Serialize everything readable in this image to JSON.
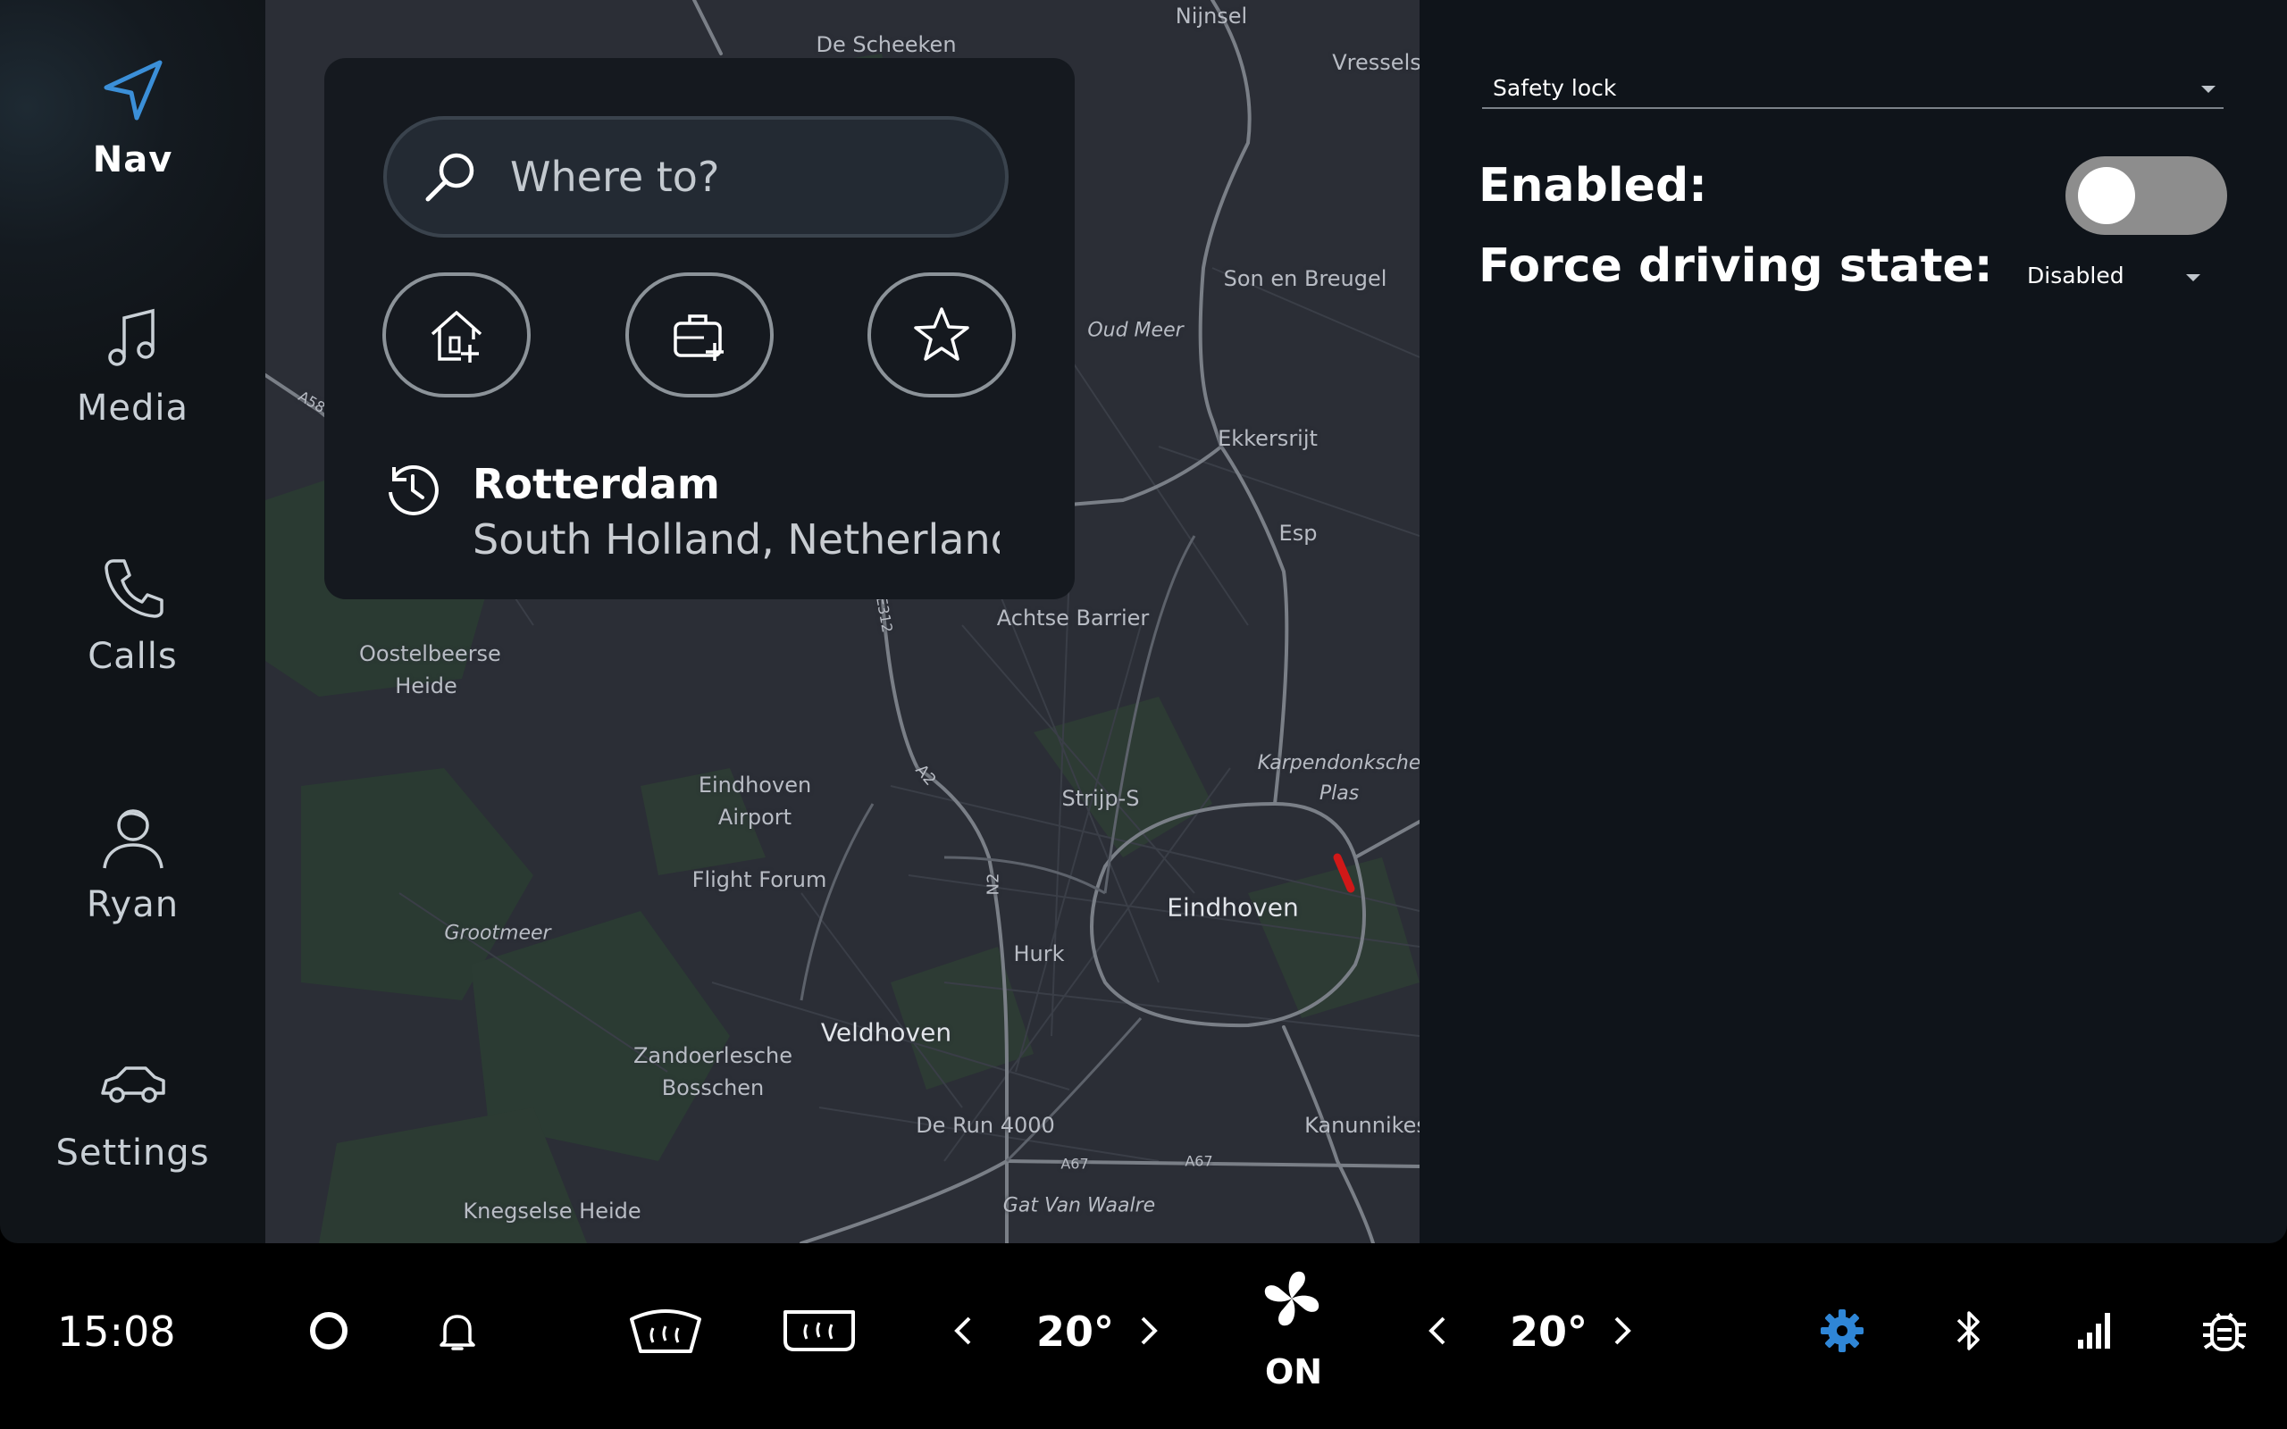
{
  "sidebar": {
    "items": [
      {
        "label": "Nav",
        "icon": "navigation-arrow-icon",
        "active": true
      },
      {
        "label": "Media",
        "icon": "music-note-icon"
      },
      {
        "label": "Calls",
        "icon": "phone-icon"
      },
      {
        "label": "Ryan",
        "icon": "user-profile-icon"
      },
      {
        "label": "Settings",
        "icon": "car-icon"
      }
    ],
    "active_color": "#3b8fd8"
  },
  "map": {
    "labels": [
      "De Scheeken",
      "Nijnsel",
      "Vressels",
      "Son en Breugel",
      "Oud Meer",
      "Ekkersrijt",
      "Esp",
      "Achtse Barrier",
      "Oostelbeerse Heide",
      "Eindhoven Airport",
      "Strijp-S",
      "Karpendonksche Plas",
      "Flight Forum",
      "Eindhoven",
      "Hurk",
      "Grootmeer",
      "Veldhoven",
      "Zandoerlesche Bosschen",
      "De Run 4000",
      "Kanunnikes",
      "Gat Van Waalre",
      "Knegselse Heide",
      "A2",
      "N2",
      "A67",
      "A67",
      "E312",
      "A58"
    ]
  },
  "search": {
    "placeholder": "Where to?",
    "quick_actions": [
      "add-home-icon",
      "add-work-icon",
      "favorites-star-icon"
    ],
    "recent": {
      "title": "Rotterdam",
      "subtitle": "South Holland, Netherlands"
    }
  },
  "panel": {
    "selector_value": "Safety lock",
    "enabled_label": "Enabled:",
    "enabled": false,
    "force_label": "Force driving state:",
    "force_value": "Disabled"
  },
  "bottom_bar": {
    "time": "15:08",
    "left_temp": "20°",
    "right_temp": "20°",
    "fan_status": "ON",
    "accent_color": "#2f86d6"
  }
}
